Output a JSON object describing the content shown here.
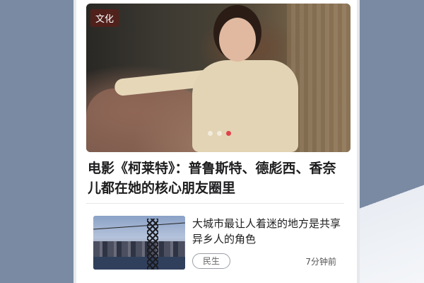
{
  "colors": {
    "background": "#7a8aa3",
    "active_dot": "#e0424a",
    "tag_bg": "#5a1e19"
  },
  "featured": {
    "category_tag": "文化",
    "headline": "电影《柯莱特》：普鲁斯特、德彪西、香奈儿都在她的核心朋友圈里",
    "carousel": {
      "total": 3,
      "active": 3
    }
  },
  "news_items": [
    {
      "title": "大城市最让人着迷的地方是共享异乡人的角色",
      "tag": "民生",
      "time": "7分钟前",
      "thumbnail": "city-bridge-image"
    }
  ]
}
